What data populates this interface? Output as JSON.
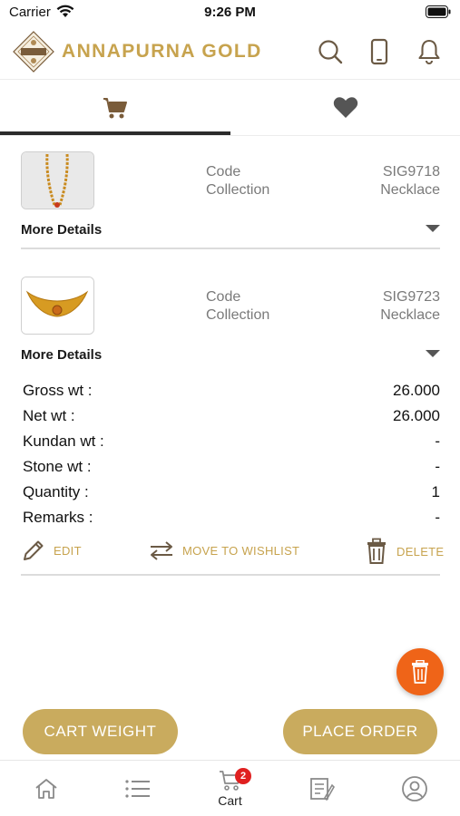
{
  "status_bar": {
    "carrier": "Carrier",
    "time": "9:26 PM"
  },
  "header": {
    "brand": "ANNAPURNA GOLD"
  },
  "colors": {
    "gold": "#c7a34e",
    "button": "#c9ab5e",
    "fab": "#ef6418",
    "badge": "#e02020"
  },
  "icons": {
    "header": [
      "search-icon",
      "phone-icon",
      "bell-icon"
    ],
    "tabs": [
      "cart-icon",
      "heart-icon"
    ],
    "nav": [
      "home-icon",
      "list-icon",
      "cart-icon",
      "catalog-icon",
      "profile-icon"
    ]
  },
  "cart_items": [
    {
      "code_label": "Code",
      "code_value": "SIG9718",
      "collection_label": "Collection",
      "collection_value": "Necklace",
      "more_details": "More Details"
    },
    {
      "code_label": "Code",
      "code_value": "SIG9723",
      "collection_label": "Collection",
      "collection_value": "Necklace",
      "more_details": "More Details",
      "details": [
        {
          "label": "Gross wt :",
          "value": "26.000"
        },
        {
          "label": "Net wt :",
          "value": "26.000"
        },
        {
          "label": "Kundan wt :",
          "value": "-"
        },
        {
          "label": "Stone wt :",
          "value": "-"
        },
        {
          "label": "Quantity :",
          "value": "1"
        },
        {
          "label": "Remarks :",
          "value": "-"
        }
      ],
      "actions": {
        "edit": "EDIT",
        "move": "MOVE TO WISHLIST",
        "delete": "DELETE"
      }
    }
  ],
  "buttons": {
    "cart_weight": "CART WEIGHT",
    "place_order": "PLACE ORDER"
  },
  "bottom_nav": {
    "cart_label": "Cart",
    "cart_badge": "2"
  }
}
